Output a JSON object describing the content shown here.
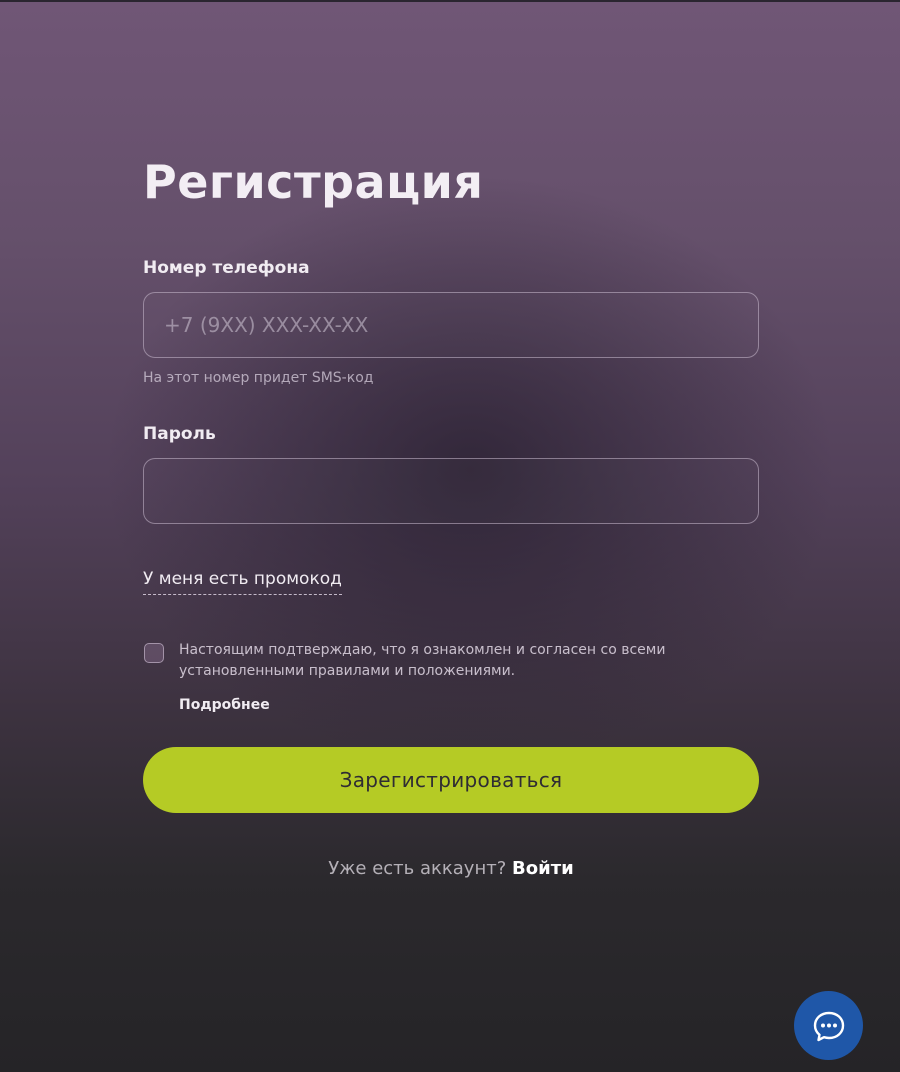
{
  "page": {
    "title": "Регистрация"
  },
  "phone": {
    "label": "Номер телефона",
    "placeholder": "+7 (9XX) XXX-XX-XX",
    "value": "",
    "hint": "На этот номер придет SMS-код"
  },
  "password": {
    "label": "Пароль",
    "placeholder": "",
    "value": ""
  },
  "promo": {
    "link_label": "У меня есть промокод"
  },
  "consent": {
    "checked": false,
    "text": "Настоящим подтверждаю, что я ознакомлен и согласен со всеми установленными правилами и положениями.",
    "more_label": "Подробнее"
  },
  "submit": {
    "label": "Зарегистрироваться"
  },
  "login": {
    "question": "Уже есть аккаунт?",
    "link_label": "Войти"
  },
  "chat": {
    "icon": "chat-bubble-icon"
  },
  "colors": {
    "accent": "#b5cb25",
    "chat_button": "#1f57a8"
  }
}
